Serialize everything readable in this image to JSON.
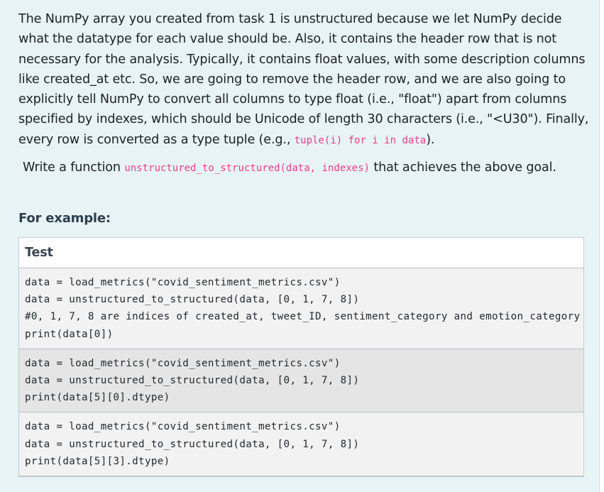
{
  "description": {
    "paragraph_text": "The NumPy array you created from task 1 is unstructured because we let NumPy decide what the datatype for each value should be. Also, it contains the header row that is not necessary for the analysis. Typically, it contains float values, with some description columns like created_at etc. So, we are going to remove the header row, and we are also going to explicitly tell NumPy to convert all columns to type float (i.e., \"float\") apart from columns specified by indexes, which should be Unicode of length 30 characters (i.e., \"<U30\"). Finally, every row is converted as a type tuple (e.g., ",
    "paragraph_code": "tuple(i) for i in data",
    "paragraph_end": ").",
    "task_prefix": "Write a function ",
    "task_code": "unstructured_to_structured(data, indexes)",
    "task_suffix": " that achieves the above goal."
  },
  "example": {
    "heading": "For example:",
    "table_header": "Test",
    "tests": [
      {
        "lines": [
          "data = load_metrics(\"covid_sentiment_metrics.csv\")",
          "data = unstructured_to_structured(data, [0, 1, 7, 8])",
          "#0, 1, 7, 8 are indices of created_at, tweet_ID, sentiment_category and emotion_category",
          "print(data[0])"
        ]
      },
      {
        "lines": [
          "data = load_metrics(\"covid_sentiment_metrics.csv\")",
          "data = unstructured_to_structured(data, [0, 1, 7, 8])",
          "print(data[5][0].dtype)"
        ]
      },
      {
        "lines": [
          "data = load_metrics(\"covid_sentiment_metrics.csv\")",
          "data = unstructured_to_structured(data, [0, 1, 7, 8])",
          "print(data[5][3].dtype)"
        ]
      }
    ]
  },
  "colors": {
    "panel_background": "#e7f3f5",
    "inline_code": "#e83e8c",
    "heading": "#2d3e4f"
  }
}
